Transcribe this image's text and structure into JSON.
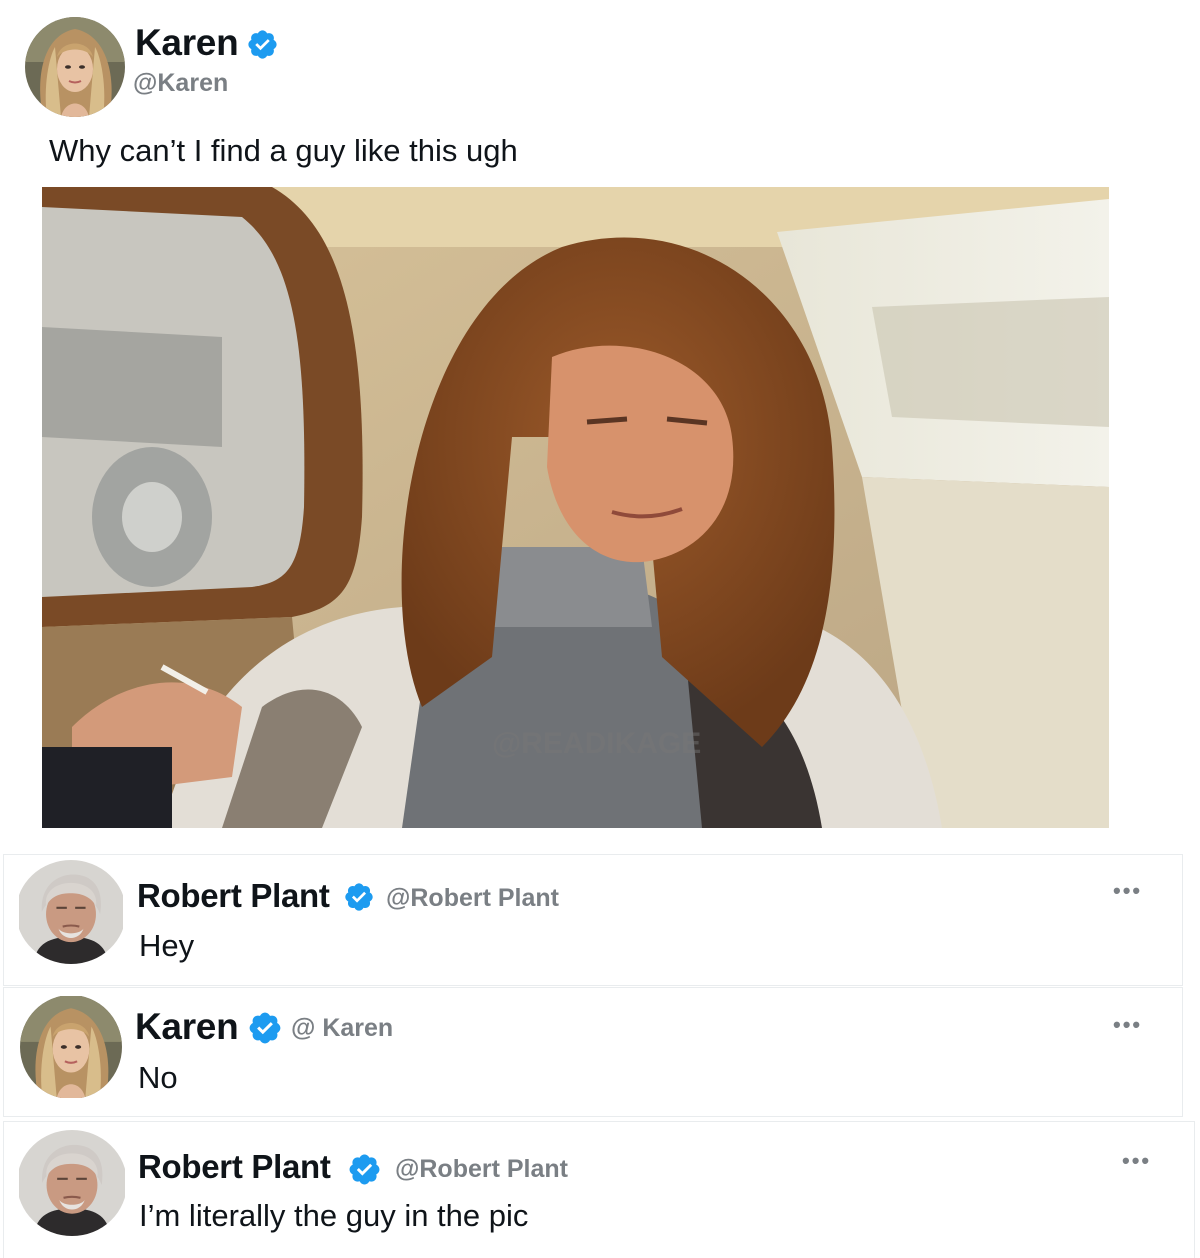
{
  "tweet": {
    "author_name": "Karen",
    "author_handle": "@Karen",
    "text": "Why can’t I find a guy like this ugh",
    "photo_watermark": "@READIKAGE",
    "verified_icon": "verified-badge-icon",
    "avatar": "karen-avatar"
  },
  "replies": [
    {
      "author_name": "Robert Plant",
      "author_handle": "@Robert Plant",
      "text": "Hey",
      "more_label": "•••",
      "avatar": "robert-plant-avatar"
    },
    {
      "author_name": "Karen",
      "author_handle": "@ Karen",
      "text": "No",
      "more_label": "•••",
      "avatar": "karen-avatar"
    },
    {
      "author_name": "Robert Plant",
      "author_handle": "@Robert Plant",
      "text": "I’m literally the guy in the pic",
      "more_label": "•••",
      "avatar": "robert-plant-avatar"
    }
  ],
  "colors": {
    "verified_blue": "#1d9bf0",
    "handle_gray": "#7a7f84",
    "text": "#0f1419"
  }
}
